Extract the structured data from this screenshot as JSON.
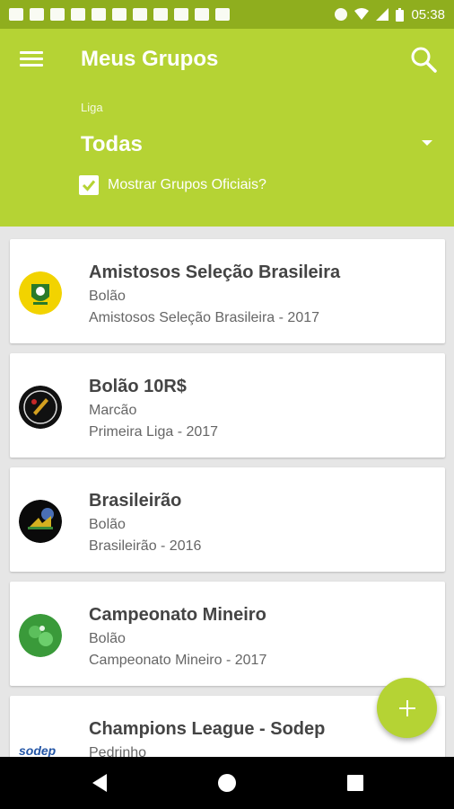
{
  "status_bar": {
    "time": "05:38"
  },
  "app_bar": {
    "title": "Meus Grupos",
    "league_label": "Liga",
    "league_value": "Todas",
    "show_official_label": "Mostrar Grupos Oficiais?",
    "show_official_checked": true
  },
  "groups": [
    {
      "name": "Amistosos Seleção Brasileira",
      "owner": "Bolão",
      "league": "Amistosos Seleção Brasileira - 2017",
      "logo": "cbf-logo"
    },
    {
      "name": "Bolão 10R$",
      "owner": "Marcão",
      "league": "Primeira Liga - 2017",
      "logo": "primeira-liga-logo"
    },
    {
      "name": "Brasileirão",
      "owner": "Bolão",
      "league": "Brasileirão - 2016",
      "logo": "brasileirao-logo"
    },
    {
      "name": "Campeonato Mineiro",
      "owner": "Bolão",
      "league": "Campeonato Mineiro - 2017",
      "logo": "campeonato-mineiro-logo"
    },
    {
      "name": "Champions League - Sodep",
      "owner": "Pedrinho",
      "league": "",
      "logo": "sodep-logo",
      "logo_text": "sodep"
    }
  ],
  "colors": {
    "primary": "#b5d334",
    "status_bar": "#8fae1e",
    "accent": "#b5d334"
  }
}
